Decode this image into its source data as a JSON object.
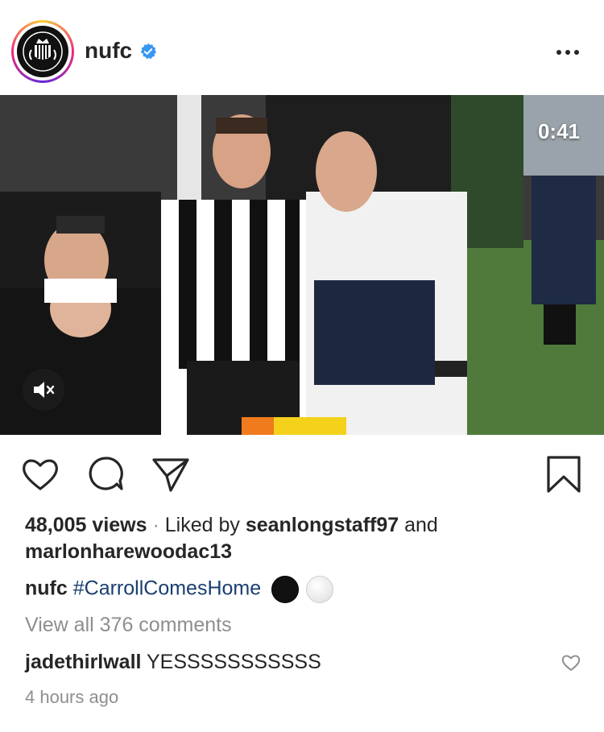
{
  "header": {
    "username": "nufc",
    "avatar_icon": "club-crest-avatar",
    "verified_icon": "verified-badge-icon",
    "more_icon": "more-options-icon"
  },
  "media": {
    "video_timer": "0:41",
    "mute_icon": "speaker-muted-icon"
  },
  "actions": {
    "like_icon": "heart-icon",
    "comment_icon": "comment-bubble-icon",
    "share_icon": "paper-plane-icon",
    "save_icon": "bookmark-icon"
  },
  "engagement": {
    "views": "48,005 views",
    "separator": "·",
    "liked_by_prefix": "Liked by",
    "liked_user_1": "seanlongstaff97",
    "and_word": "and",
    "liked_user_2": "marlonharewoodac13"
  },
  "caption": {
    "username": "nufc",
    "hashtag": "#CarrollComesHome",
    "emoji_1": "black-circle",
    "emoji_2": "white-circle"
  },
  "comments": {
    "view_all": "View all 376 comments",
    "items": [
      {
        "username": "jadethirlwall",
        "text": "YESSSSSSSSSSS"
      }
    ]
  },
  "timestamp": "4 hours ago",
  "colors": {
    "text": "#262626",
    "muted": "#8e8e8e",
    "hashtag": "#1a3e70",
    "verified": "#3897f0"
  }
}
